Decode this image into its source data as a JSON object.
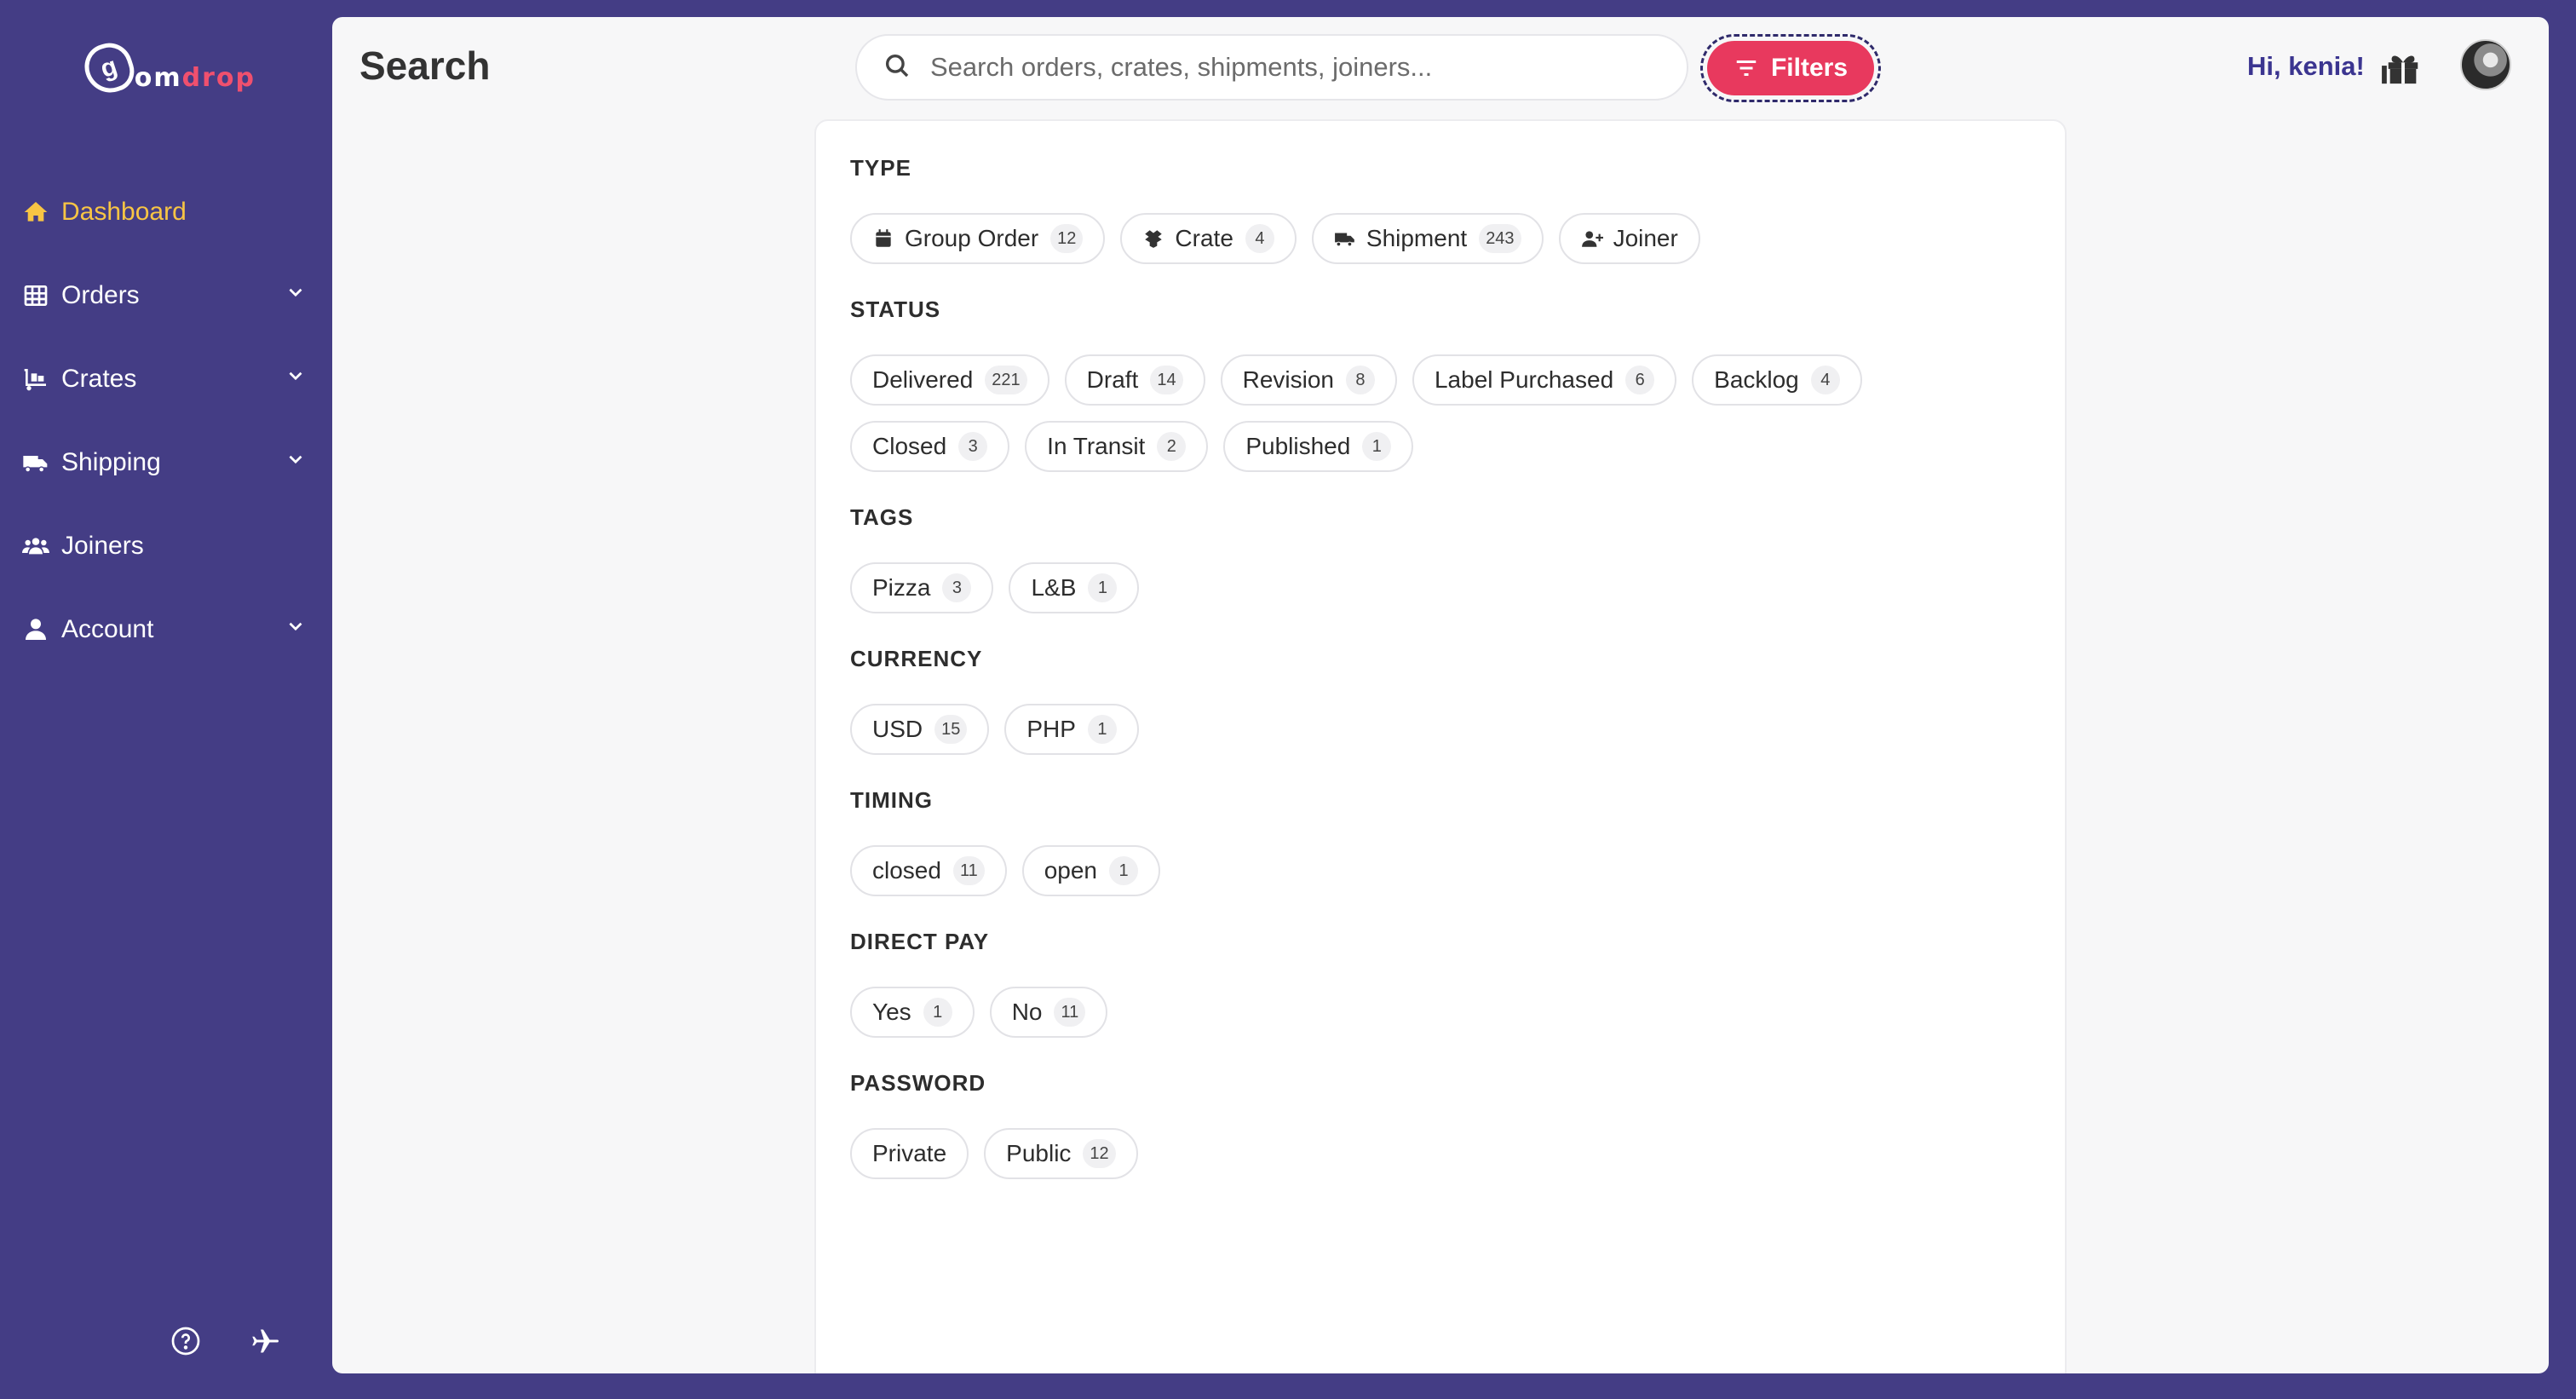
{
  "sidebar": {
    "logo": {
      "mark": "g",
      "white": "om",
      "pink": "drop"
    },
    "items": [
      {
        "label": "Dashboard",
        "icon": "home-icon"
      },
      {
        "label": "Orders",
        "icon": "table-icon"
      },
      {
        "label": "Crates",
        "icon": "dolly-icon"
      },
      {
        "label": "Shipping",
        "icon": "truck-icon"
      },
      {
        "label": "Joiners",
        "icon": "users-icon"
      },
      {
        "label": "Account",
        "icon": "user-icon"
      }
    ]
  },
  "header": {
    "title": "Search",
    "search_placeholder": "Search orders, crates, shipments, joiners...",
    "filters_label": "Filters",
    "greeting": "Hi, kenia!"
  },
  "filters": {
    "type": {
      "title": "TYPE",
      "chips": [
        {
          "label": "Group Order",
          "count": "12"
        },
        {
          "label": "Crate",
          "count": "4"
        },
        {
          "label": "Shipment",
          "count": "243"
        },
        {
          "label": "Joiner",
          "count": ""
        }
      ]
    },
    "status": {
      "title": "STATUS",
      "chips": [
        {
          "label": "Delivered",
          "count": "221"
        },
        {
          "label": "Draft",
          "count": "14"
        },
        {
          "label": "Revision",
          "count": "8"
        },
        {
          "label": "Label Purchased",
          "count": "6"
        },
        {
          "label": "Backlog",
          "count": "4"
        },
        {
          "label": "Closed",
          "count": "3"
        },
        {
          "label": "In Transit",
          "count": "2"
        },
        {
          "label": "Published",
          "count": "1"
        }
      ]
    },
    "tags": {
      "title": "TAGS",
      "chips": [
        {
          "label": "Pizza",
          "count": "3"
        },
        {
          "label": "L&B",
          "count": "1"
        }
      ]
    },
    "currency": {
      "title": "CURRENCY",
      "chips": [
        {
          "label": "USD",
          "count": "15"
        },
        {
          "label": "PHP",
          "count": "1"
        }
      ]
    },
    "timing": {
      "title": "TIMING",
      "chips": [
        {
          "label": "closed",
          "count": "11"
        },
        {
          "label": "open",
          "count": "1"
        }
      ]
    },
    "direct_pay": {
      "title": "DIRECT PAY",
      "chips": [
        {
          "label": "Yes",
          "count": "1"
        },
        {
          "label": "No",
          "count": "11"
        }
      ]
    },
    "password": {
      "title": "PASSWORD",
      "chips": [
        {
          "label": "Private",
          "count": ""
        },
        {
          "label": "Public",
          "count": "12"
        }
      ]
    }
  },
  "colors": {
    "sidebar_bg": "#443d85",
    "active_nav": "#f8c544",
    "filters_button": "#e8395e",
    "greeting": "#3b3590"
  }
}
